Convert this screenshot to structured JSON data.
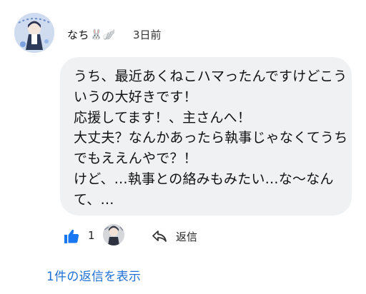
{
  "comment": {
    "author": "なち",
    "author_emojis": "🐰🪽",
    "timestamp": "3日前",
    "body_lines": [
      "うち、最近あくねこハマったんですけどこう",
      "いうの大好きです！",
      "応援してます！、主さんへ！",
      "大丈夫？なんかあったら執事じゃなくてうち",
      "でもええんやで？！",
      "けど、…執事との絡みもみたい…な〜なん",
      "て、…"
    ],
    "like_count": "1",
    "reply_label": "返信"
  },
  "replies": {
    "view_label": "1件の返信を表示"
  },
  "colors": {
    "accent": "#1f70d6",
    "bubble": "#f0f1f3",
    "like": "#1877f2"
  }
}
